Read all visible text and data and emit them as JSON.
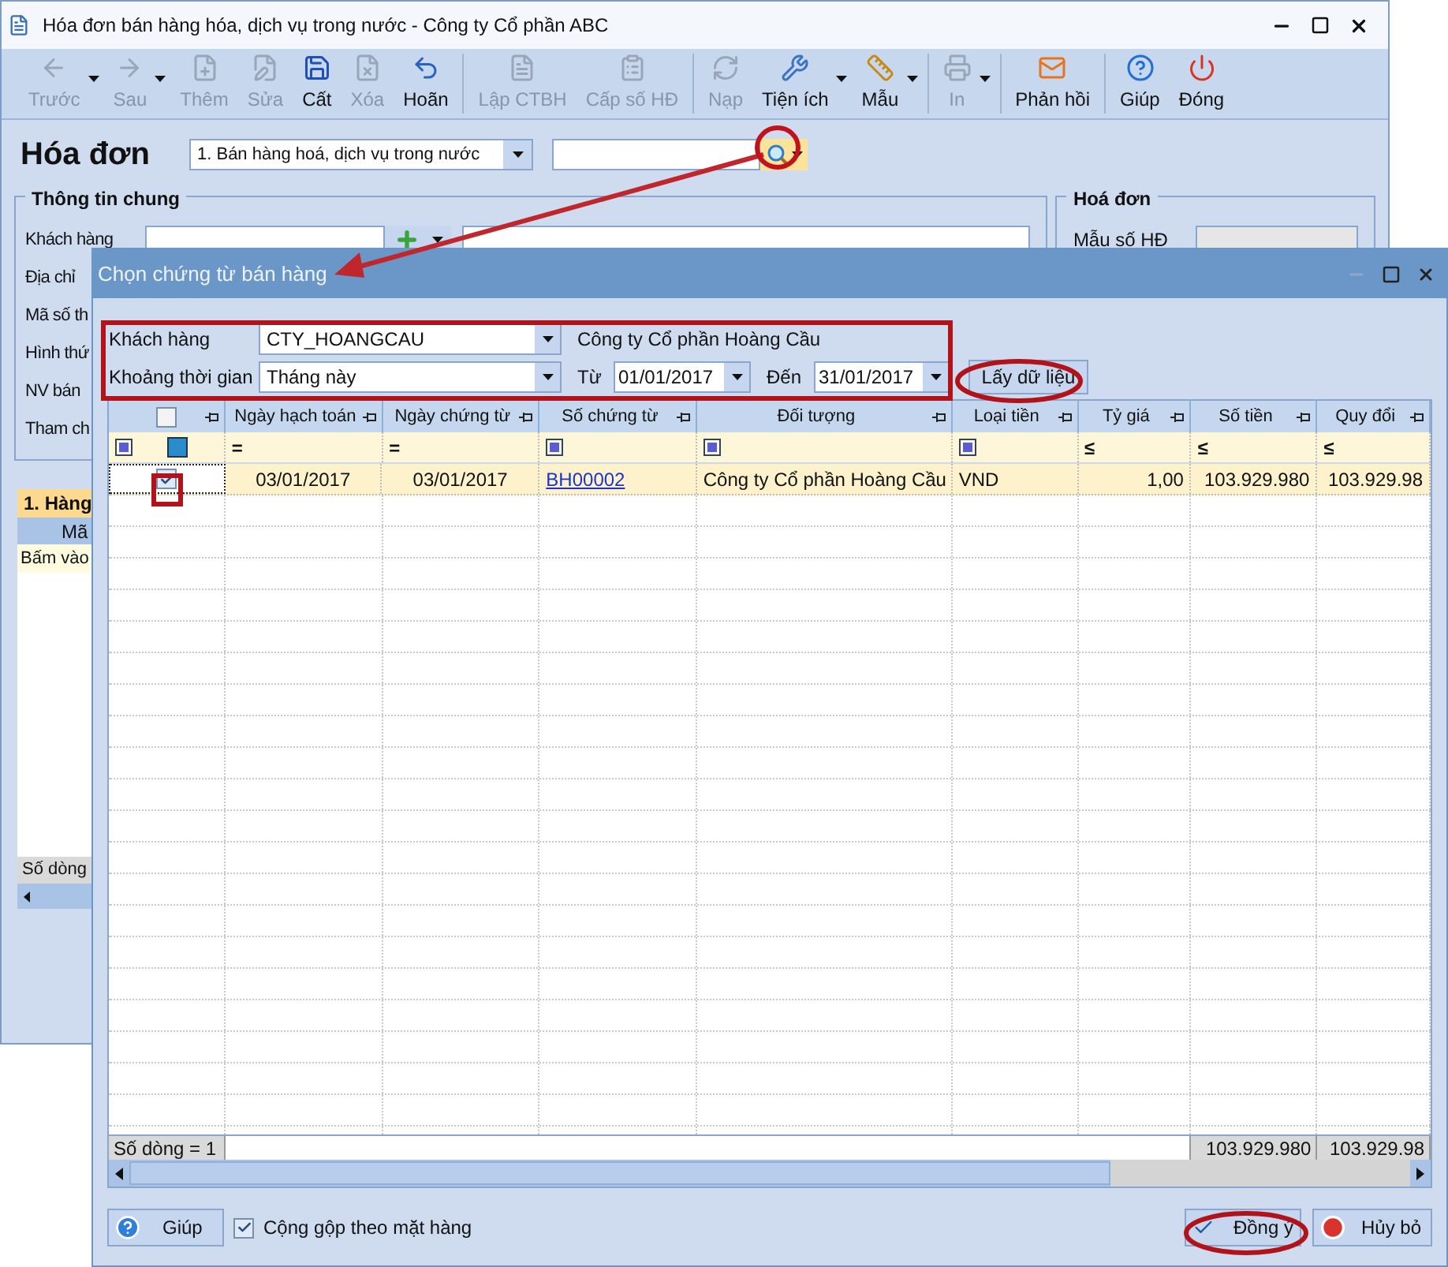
{
  "window": {
    "title": "Hóa đơn bán hàng hóa, dịch vụ trong nước - Công ty Cổ phần ABC"
  },
  "toolbar_groups": [
    [
      {
        "label": "Trước",
        "kind": "back",
        "disabled": true,
        "dropdown": true
      },
      {
        "label": "Sau",
        "kind": "forward",
        "disabled": true,
        "dropdown": true
      },
      {
        "label": "Thêm",
        "kind": "add",
        "disabled": true,
        "dropdown": false
      },
      {
        "label": "Sửa",
        "kind": "edit",
        "disabled": true,
        "dropdown": false
      },
      {
        "label": "Cất",
        "kind": "save",
        "disabled": false,
        "dropdown": false
      },
      {
        "label": "Xóa",
        "kind": "delete",
        "disabled": true,
        "dropdown": false
      },
      {
        "label": "Hoãn",
        "kind": "undo",
        "disabled": false,
        "dropdown": false
      }
    ],
    [
      {
        "label": "Lập CTBH",
        "kind": "doc",
        "disabled": true,
        "dropdown": false
      },
      {
        "label": "Cấp số HĐ",
        "kind": "list",
        "disabled": true,
        "dropdown": false
      }
    ],
    [
      {
        "label": "Nạp",
        "kind": "reload",
        "disabled": true,
        "dropdown": false
      },
      {
        "label": "Tiện ích",
        "kind": "tools",
        "disabled": false,
        "dropdown": true
      },
      {
        "label": "Mẫu",
        "kind": "ruler",
        "disabled": false,
        "dropdown": true
      }
    ],
    [
      {
        "label": "In",
        "kind": "print",
        "disabled": true,
        "dropdown": true
      }
    ],
    [
      {
        "label": "Phản hồi",
        "kind": "mail",
        "disabled": false,
        "dropdown": false
      }
    ],
    [
      {
        "label": "Giúp",
        "kind": "help",
        "disabled": false,
        "dropdown": false
      },
      {
        "label": "Đóng",
        "kind": "power",
        "disabled": false,
        "dropdown": false
      }
    ]
  ],
  "form": {
    "title": "Hóa đơn",
    "type_value": "1. Bán hàng hoá, dịch vụ trong nước"
  },
  "general_info": {
    "title": "Thông tin chung",
    "labels": [
      "Khách hàng",
      "Địa chỉ",
      "Mã số th",
      "Hình thứ",
      "NV bán",
      "Tham ch"
    ]
  },
  "invoice_group": {
    "title": "Hoá đơn",
    "labels": [
      "Mẫu số HĐ"
    ]
  },
  "detail": {
    "tab": "1. Hàng",
    "column": "Mã",
    "hint": "Bấm vào",
    "footer": "Số dòng"
  },
  "dialog": {
    "title": "Chọn chứng từ bán hàng",
    "customer_label": "Khách hàng",
    "customer_value": "CTY_HOANGCAU",
    "customer_name": "Công ty Cổ phần Hoàng Cầu",
    "period_label": "Khoảng thời gian",
    "period_value": "Tháng này",
    "from_label": "Từ",
    "from_value": "01/01/2017",
    "to_label": "Đến",
    "to_value": "31/01/2017",
    "fetch_button": "Lấy dữ liệu",
    "all_checked": false,
    "columns": [
      "Ngày hạch toán",
      "Ngày chứng từ",
      "Số chứng từ",
      "Đối tượng",
      "Loại tiền",
      "Tỷ giá",
      "Số tiền",
      "Quy đổi"
    ],
    "filter_row": [
      {
        "kind": "op",
        "text": "="
      },
      {
        "kind": "op",
        "text": "="
      },
      {
        "kind": "square"
      },
      {
        "kind": "square"
      },
      {
        "kind": "square"
      },
      {
        "kind": "op",
        "text": "≤"
      },
      {
        "kind": "op",
        "text": "≤"
      },
      {
        "kind": "op",
        "text": "≤"
      }
    ],
    "rows": [
      {
        "checked": true,
        "cells": [
          "03/01/2017",
          "03/01/2017",
          "BH00002",
          "Công ty Cổ phần Hoàng Cầu",
          "VND",
          "1,00",
          "103.929.980",
          "103.929.98"
        ]
      }
    ],
    "footer_count": "Số dòng = 1",
    "footer_totals": [
      "103.929.980",
      "103.929.98"
    ],
    "help_button": "Giúp",
    "merge": {
      "label": "Cộng gộp theo mặt hàng",
      "checked": true
    },
    "ok_button": "Đồng ý",
    "cancel_button": "Hủy bỏ"
  }
}
